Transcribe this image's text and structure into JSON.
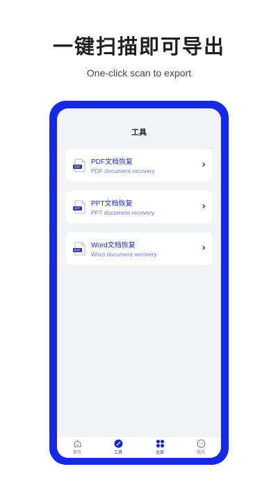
{
  "promo": {
    "title": "一键扫描即可导出",
    "subtitle": "One-click scan to export"
  },
  "header": {
    "title": "工具"
  },
  "tools": [
    {
      "title": "PDF文档恢复",
      "subtitle": "PDF document recovery",
      "badge": "PDF",
      "icon": "pdf-file-icon"
    },
    {
      "title": "PPT文档恢复",
      "subtitle": "PPT document recovery",
      "badge": "PPT",
      "icon": "ppt-file-icon"
    },
    {
      "title": "Word文档恢复",
      "subtitle": "Word document recovery",
      "badge": "DOC",
      "icon": "doc-file-icon"
    }
  ],
  "tabs": [
    {
      "label": "首页",
      "icon": "home-icon",
      "active": false
    },
    {
      "label": "工具",
      "icon": "tool-icon",
      "active": true
    },
    {
      "label": "全部",
      "icon": "grid-icon",
      "active": true
    },
    {
      "label": "我的",
      "icon": "profile-face-icon",
      "active": false
    }
  ],
  "colors": {
    "accent": "#1428e6",
    "accent_text": "#1b2bd0",
    "screen_bg": "#f3f4f6"
  }
}
